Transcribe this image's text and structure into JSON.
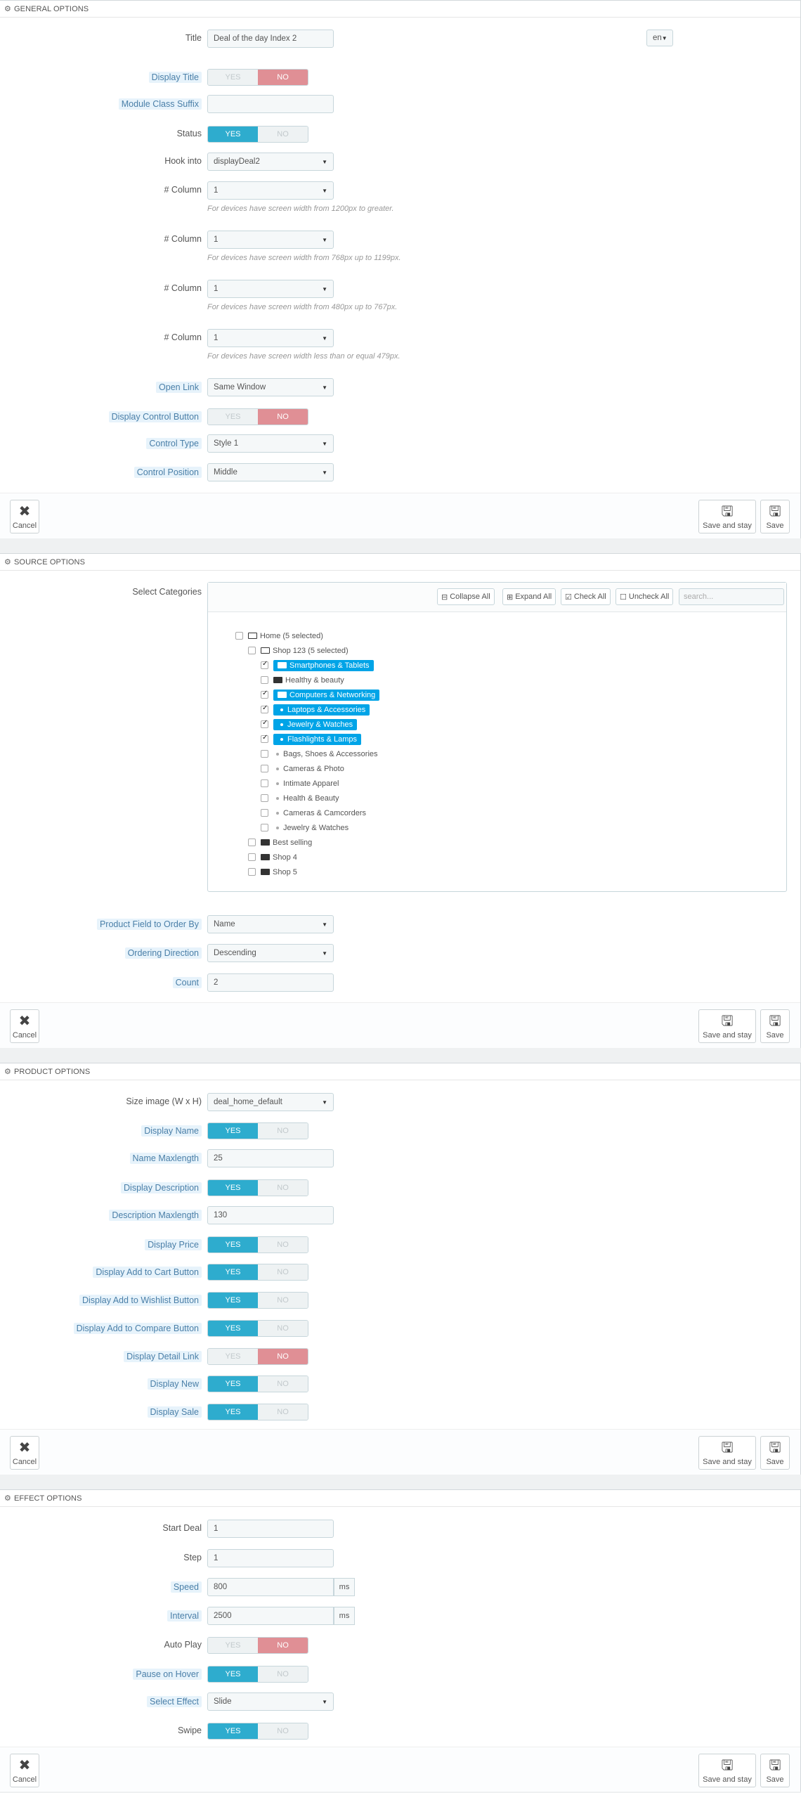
{
  "general": {
    "heading": "GENERAL OPTIONS",
    "title_label": "Title",
    "title_value": "Deal of the day Index 2",
    "lang": "en",
    "display_title_label": "Display Title",
    "module_class_suffix_label": "Module Class Suffix",
    "status_label": "Status",
    "hook_into_label": "Hook into",
    "hook_into_value": "displayDeal2",
    "column_label": "# Column",
    "column_value": "1",
    "column_help_1": "For devices have screen width from 1200px to greater.",
    "column_help_2": "For devices have screen width from 768px up to 1199px.",
    "column_help_3": "For devices have screen width from 480px up to 767px.",
    "column_help_4": "For devices have screen width less than or equal 479px.",
    "open_link_label": "Open Link",
    "open_link_value": "Same Window",
    "display_control_button_label": "Display Control Button",
    "control_type_label": "Control Type",
    "control_type_value": "Style 1",
    "control_position_label": "Control Position",
    "control_position_value": "Middle"
  },
  "toggle": {
    "yes": "YES",
    "no": "NO"
  },
  "buttons": {
    "cancel": "Cancel",
    "save_and_stay": "Save and stay",
    "save": "Save"
  },
  "source": {
    "heading": "SOURCE OPTIONS",
    "select_categories_label": "Select Categories",
    "collapse_all": "Collapse All",
    "expand_all": "Expand All",
    "check_all": "Check All",
    "uncheck_all": "Uncheck All",
    "search_placeholder": "search...",
    "tree": {
      "home": "Home (5 selected)",
      "shop123": "Shop 123 (5 selected)",
      "n1": "Smartphones & Tablets",
      "n2": "Healthy & beauty",
      "n3": "Computers & Networking",
      "n4": "Laptops & Accessories",
      "n5": "Jewelry & Watches",
      "n6": "Flashlights & Lamps",
      "n7": "Bags, Shoes & Accessories",
      "n8": "Cameras & Photo",
      "n9": "Intimate Apparel",
      "n10": "Health & Beauty",
      "n11": "Cameras & Camcorders",
      "n12": "Jewelry & Watches",
      "best_selling": "Best selling",
      "shop4": "Shop 4",
      "shop5": "Shop 5"
    },
    "order_by_label": "Product Field to Order By",
    "order_by_value": "Name",
    "ordering_direction_label": "Ordering Direction",
    "ordering_direction_value": "Descending",
    "count_label": "Count",
    "count_value": "2"
  },
  "product": {
    "heading": "PRODUCT OPTIONS",
    "size_image_label": "Size image (W x H)",
    "size_image_value": "deal_home_default",
    "display_name_label": "Display Name",
    "name_maxlength_label": "Name Maxlength",
    "name_maxlength_value": "25",
    "display_description_label": "Display Description",
    "description_maxlength_label": "Description Maxlength",
    "description_maxlength_value": "130",
    "display_price_label": "Display Price",
    "display_add_to_cart_label": "Display Add to Cart Button",
    "display_add_to_wishlist_label": "Display Add to Wishlist Button",
    "display_add_to_compare_label": "Display Add to Compare Button",
    "display_detail_link_label": "Display Detail Link",
    "display_new_label": "Display New",
    "display_sale_label": "Display Sale"
  },
  "effect": {
    "heading": "EFFECT OPTIONS",
    "start_deal_label": "Start Deal",
    "start_deal_value": "1",
    "step_label": "Step",
    "step_value": "1",
    "speed_label": "Speed",
    "speed_value": "800",
    "interval_label": "Interval",
    "interval_value": "2500",
    "ms": "ms",
    "auto_play_label": "Auto Play",
    "pause_on_hover_label": "Pause on Hover",
    "select_effect_label": "Select Effect",
    "select_effect_value": "Slide",
    "swipe_label": "Swipe"
  }
}
